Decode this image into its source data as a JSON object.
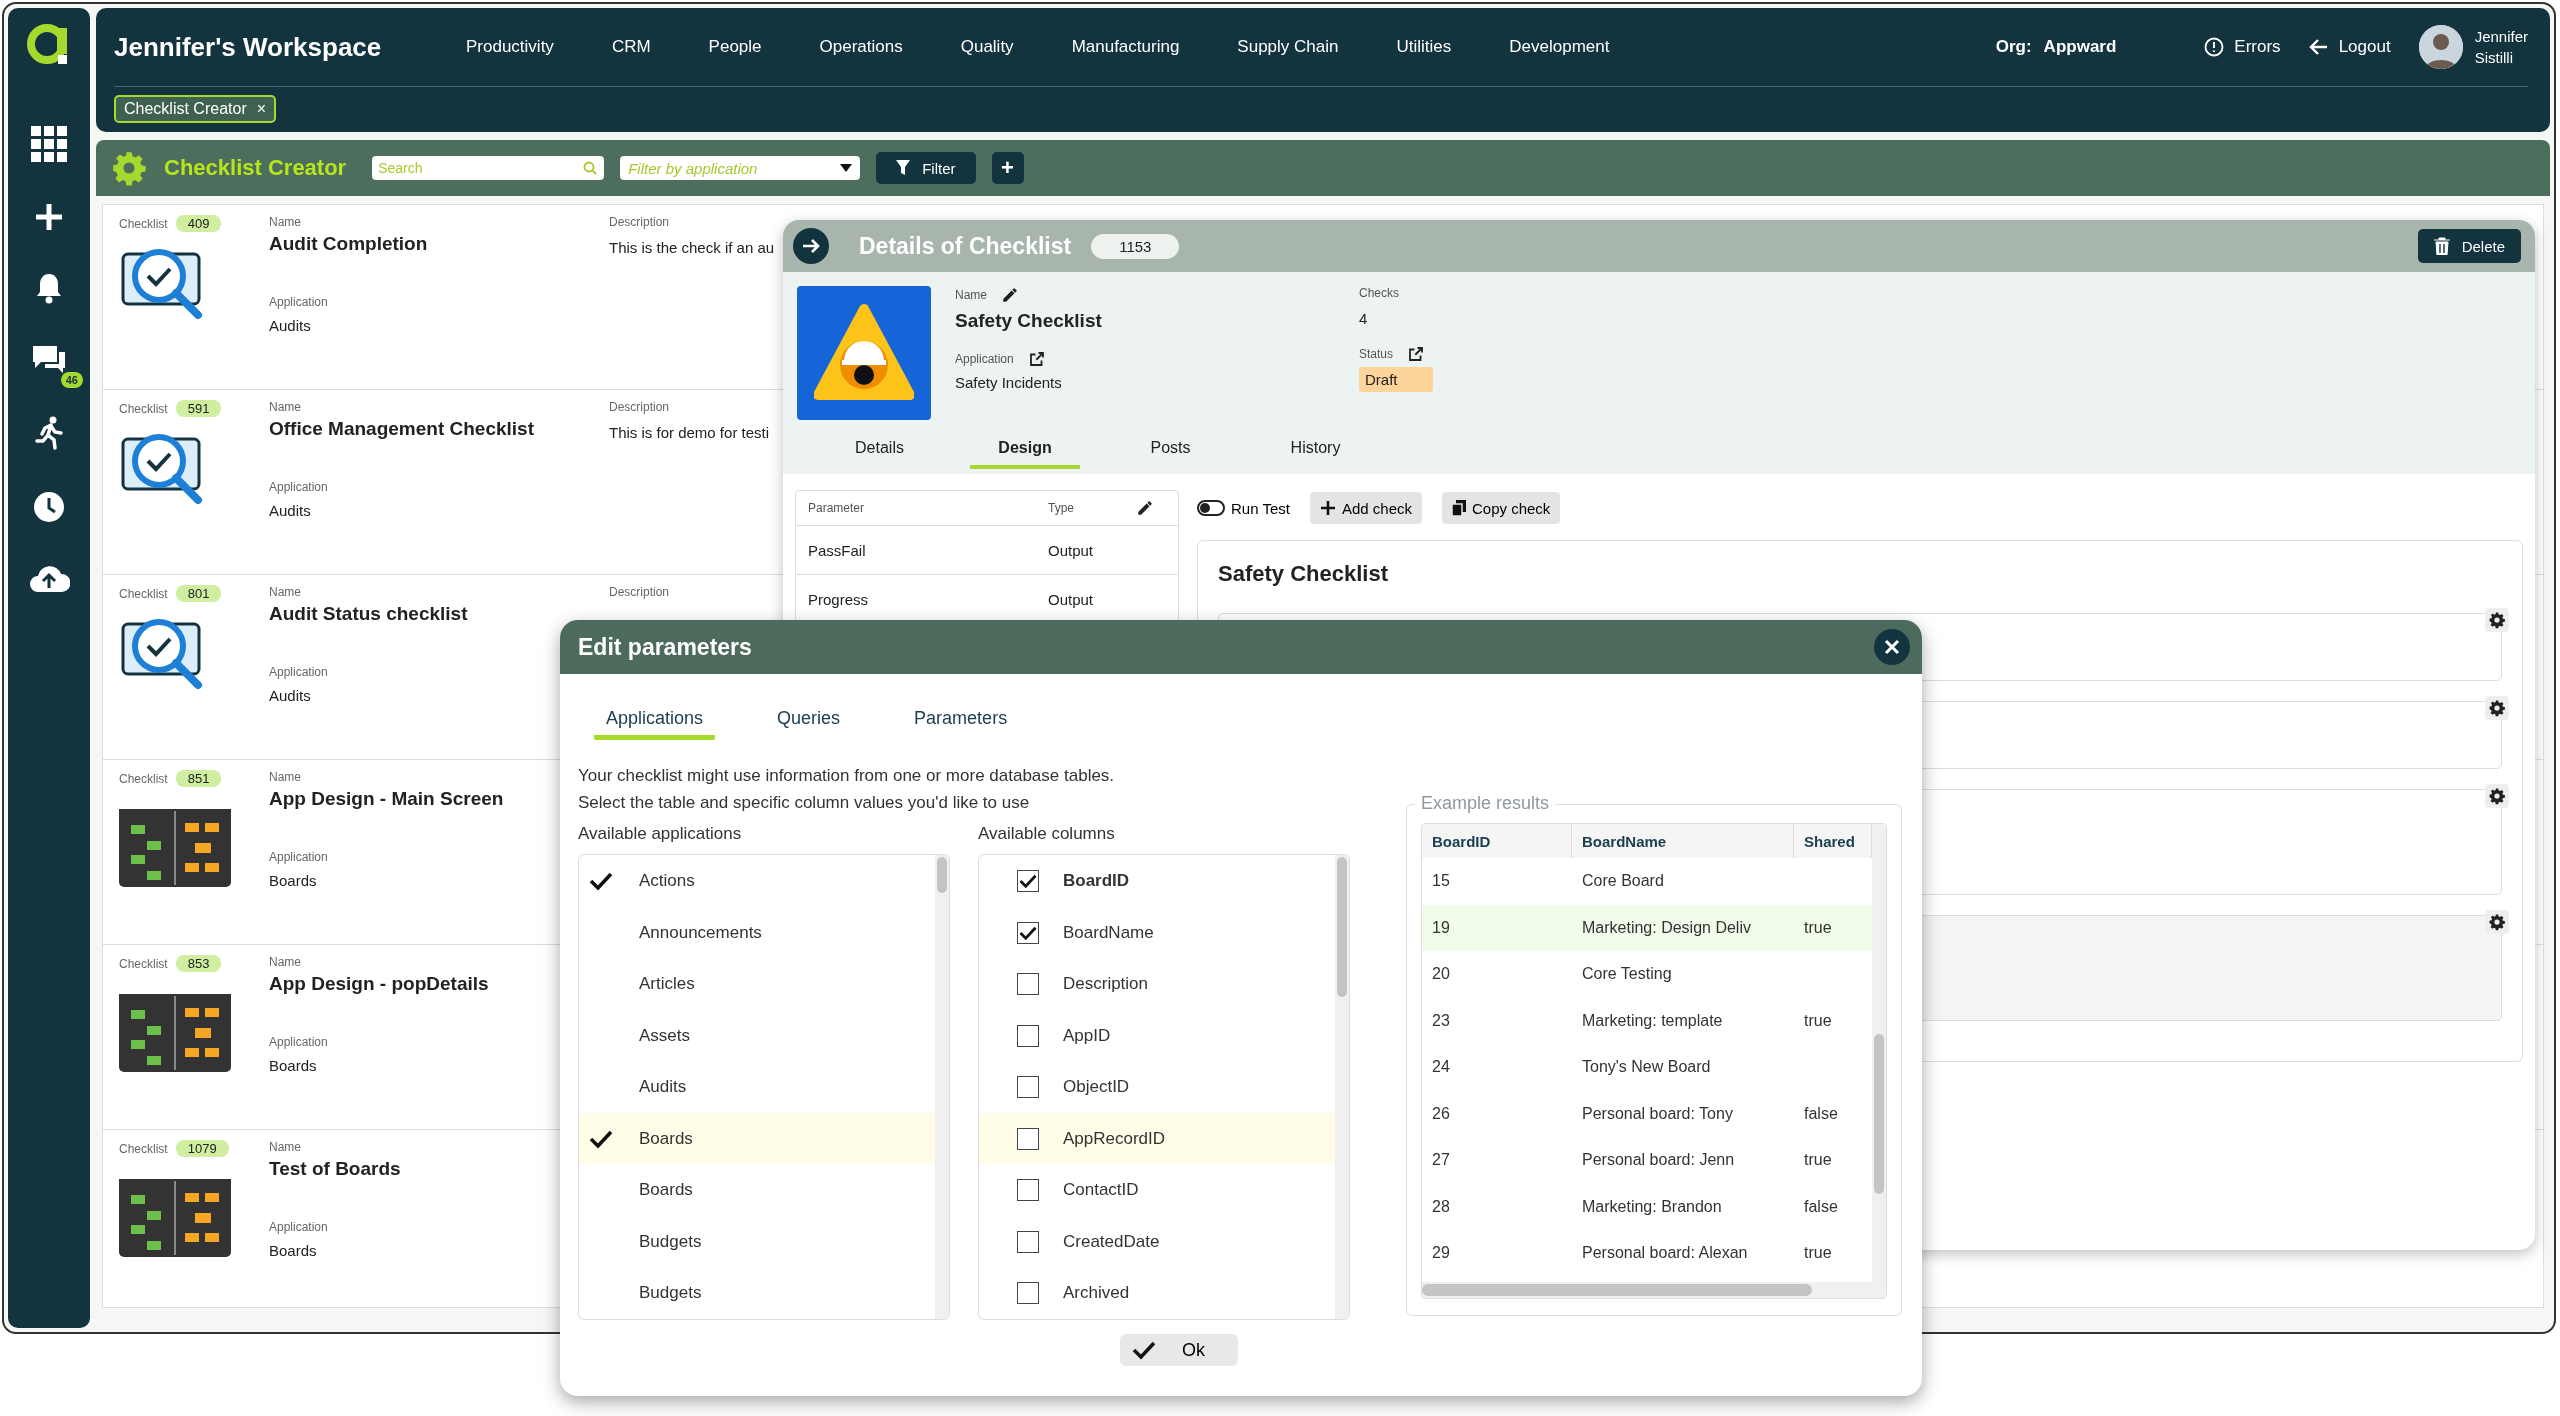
{
  "sidebar": {
    "chat_badge": "46"
  },
  "header": {
    "title": "Jennifer's Workspace",
    "menu": [
      "Productivity",
      "CRM",
      "People",
      "Operations",
      "Quality",
      "Manufacturing",
      "Supply Chain",
      "Utilities",
      "Development"
    ],
    "org_label": "Org:",
    "org": "Appward",
    "errors": "Errors",
    "logout": "Logout",
    "user": [
      "Jennifer",
      "Sistilli"
    ]
  },
  "open_tabs": [
    {
      "label": "Checklist Creator",
      "close": "×"
    }
  ],
  "toolbar": {
    "title": "Checklist Creator",
    "search_placeholder": "Search",
    "filter_placeholder": "Filter by application",
    "filter_button": "Filter",
    "add_button": "+"
  },
  "list": {
    "rows": [
      {
        "kind": "audit",
        "id_label": "Checklist",
        "id": "409",
        "name_label": "Name",
        "name": "Audit Completion",
        "app_label": "Application",
        "app": "Audits",
        "desc_label": "Description",
        "desc": "This is the check if an au"
      },
      {
        "kind": "audit",
        "id_label": "Checklist",
        "id": "591",
        "name_label": "Name",
        "name": "Office Management Checklist",
        "app_label": "Application",
        "app": "Audits",
        "desc_label": "Description",
        "desc": "This is for demo for testi"
      },
      {
        "kind": "audit",
        "id_label": "Checklist",
        "id": "801",
        "name_label": "Name",
        "name": "Audit Status checklist",
        "app_label": "Application",
        "app": "Audits",
        "desc_label": "Description"
      },
      {
        "kind": "kanban",
        "id_label": "Checklist",
        "id": "851",
        "name_label": "Name",
        "name": "App Design - Main Screen",
        "app_label": "Application",
        "app": "Boards"
      },
      {
        "kind": "kanban",
        "id_label": "Checklist",
        "id": "853",
        "name_label": "Name",
        "name": "App Design - popDetails",
        "app_label": "Application",
        "app": "Boards"
      },
      {
        "kind": "kanban",
        "id_label": "Checklist",
        "id": "1079",
        "name_label": "Name",
        "name": "Test of Boards",
        "app_label": "Application",
        "app": "Boards"
      }
    ]
  },
  "details": {
    "title": "Details of Checklist",
    "id": "1153",
    "delete": "Delete",
    "name_label": "Name",
    "name": "Safety Checklist",
    "checks_label": "Checks",
    "checks": "4",
    "app_label": "Application",
    "app": "Safety Incidents",
    "status_label": "Status",
    "status": "Draft",
    "tabs": [
      {
        "label": "Details",
        "selected": false
      },
      {
        "label": "Design",
        "selected": true
      },
      {
        "label": "Posts",
        "selected": false
      },
      {
        "label": "History",
        "selected": false
      }
    ],
    "params": {
      "columns": [
        "Parameter",
        "Type"
      ],
      "rows": [
        [
          "PassFail",
          "Output"
        ],
        [
          "Progress",
          "Output"
        ]
      ]
    },
    "run_test": {
      "label": "Run Test",
      "on": false
    },
    "add_check": "Add check",
    "copy_check": "Copy check",
    "design_title": "Safety Checklist",
    "check_cards": [
      {
        "selected": false
      },
      {
        "selected": false
      },
      {
        "selected": false
      },
      {
        "selected": true
      }
    ]
  },
  "dialog": {
    "title": "Edit parameters",
    "tabs": [
      {
        "label": "Applications",
        "selected": true
      },
      {
        "label": "Queries",
        "selected": false
      },
      {
        "label": "Parameters",
        "selected": false
      }
    ],
    "intro": [
      "Your checklist might use information from one or more database tables.",
      "Select the table and specific column values you'd like to use"
    ],
    "apps_label": "Available applications",
    "apps": [
      {
        "label": "Actions",
        "checked": true,
        "selected": false
      },
      {
        "label": "Announcements",
        "checked": false,
        "selected": false
      },
      {
        "label": "Articles",
        "checked": false,
        "selected": false
      },
      {
        "label": "Assets",
        "checked": false,
        "selected": false
      },
      {
        "label": "Audits",
        "checked": false,
        "selected": false
      },
      {
        "label": "Boards",
        "checked": true,
        "selected": true
      },
      {
        "label": "Boards",
        "checked": false,
        "selected": false
      },
      {
        "label": "Budgets",
        "checked": false,
        "selected": false
      },
      {
        "label": "Budgets",
        "checked": false,
        "selected": false
      }
    ],
    "columns_label": "Available columns",
    "columns": [
      {
        "label": "BoardID",
        "checked": true,
        "key": true,
        "selected": false
      },
      {
        "label": "BoardName",
        "checked": true,
        "key": false,
        "selected": false
      },
      {
        "label": "Description",
        "checked": false,
        "key": false,
        "selected": false
      },
      {
        "label": "AppID",
        "checked": false,
        "key": false,
        "selected": false
      },
      {
        "label": "ObjectID",
        "checked": false,
        "key": false,
        "selected": false
      },
      {
        "label": "AppRecordID",
        "checked": false,
        "key": false,
        "selected": true
      },
      {
        "label": "ContactID",
        "checked": false,
        "key": false,
        "selected": false
      },
      {
        "label": "CreatedDate",
        "checked": false,
        "key": false,
        "selected": false
      },
      {
        "label": "Archived",
        "checked": false,
        "key": false,
        "selected": false
      }
    ],
    "results": {
      "legend": "Example results",
      "columns": [
        "BoardID",
        "BoardName",
        "Shared"
      ],
      "rows": [
        {
          "id": "15",
          "name": "Core Board",
          "selected": false
        },
        {
          "id": "19",
          "name": "Marketing: Design Deliv",
          "shared": "true",
          "selected": true
        },
        {
          "id": "20",
          "name": "Core Testing",
          "selected": false
        },
        {
          "id": "23",
          "name": "Marketing: template",
          "shared": "true",
          "selected": false
        },
        {
          "id": "24",
          "name": "Tony's New Board",
          "selected": false
        },
        {
          "id": "26",
          "name": "Personal board: Tony",
          "shared": "false",
          "selected": false
        },
        {
          "id": "27",
          "name": "Personal board: Jenn",
          "shared": "true",
          "selected": false
        },
        {
          "id": "28",
          "name": "Marketing: Brandon",
          "shared": "false",
          "selected": false
        },
        {
          "id": "29",
          "name": "Personal board: Alexan",
          "shared": "true",
          "selected": false
        }
      ]
    },
    "ok": "Ok"
  }
}
